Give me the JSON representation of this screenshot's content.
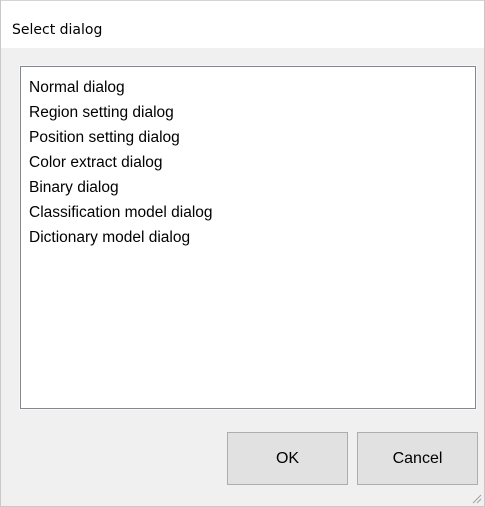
{
  "window": {
    "title": "Select dialog"
  },
  "list": {
    "items": [
      "Normal dialog",
      "Region setting dialog",
      "Position setting dialog",
      "Color extract dialog",
      "Binary dialog",
      "Classification model dialog",
      "Dictionary model dialog"
    ]
  },
  "buttons": {
    "ok_label": "OK",
    "cancel_label": "Cancel"
  },
  "icons": {
    "size_grip": "resize-grip-icon"
  },
  "colors": {
    "window_background": "#f0f0f0",
    "list_border": "#828790",
    "button_face": "#e1e1e1",
    "button_border": "#adadad"
  }
}
